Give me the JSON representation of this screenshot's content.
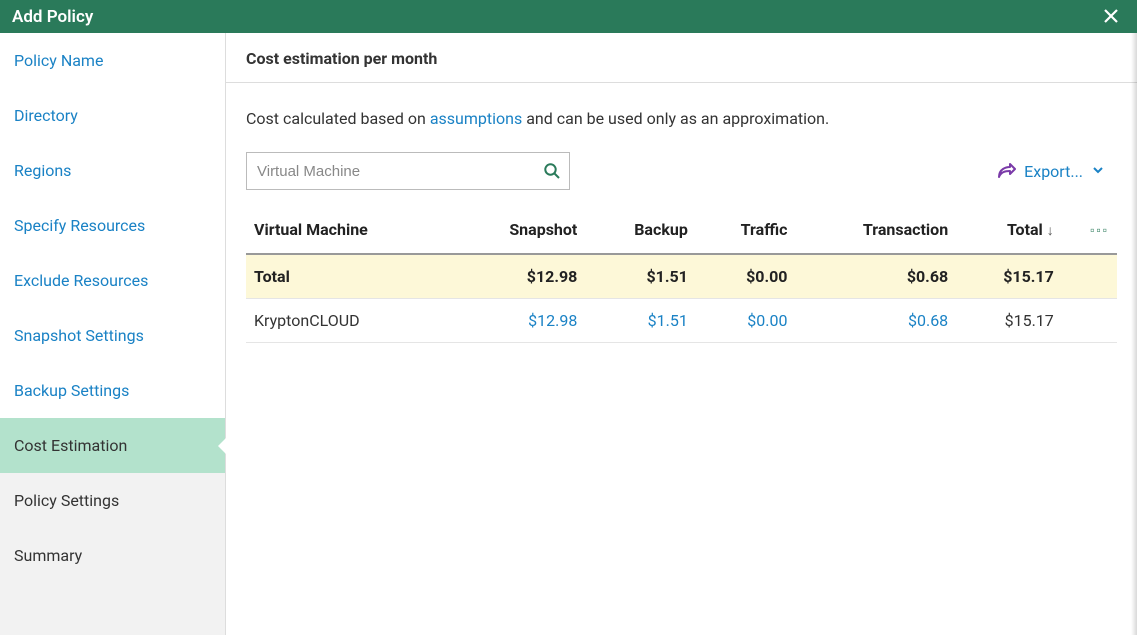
{
  "header": {
    "title": "Add Policy"
  },
  "sidebar": {
    "items": [
      {
        "label": "Policy Name"
      },
      {
        "label": "Directory"
      },
      {
        "label": "Regions"
      },
      {
        "label": "Specify Resources"
      },
      {
        "label": "Exclude Resources"
      },
      {
        "label": "Snapshot Settings"
      },
      {
        "label": "Backup Settings"
      },
      {
        "label": "Cost Estimation"
      },
      {
        "label": "Policy Settings"
      },
      {
        "label": "Summary"
      }
    ],
    "active_index": 7
  },
  "main": {
    "title": "Cost estimation per month",
    "desc_pre": "Cost calculated based on ",
    "desc_link": "assumptions",
    "desc_post": " and can be used only as an approximation.",
    "search_placeholder": "Virtual Machine",
    "export_label": "Export...",
    "columns": {
      "c0": "Virtual Machine",
      "c1": "Snapshot",
      "c2": "Backup",
      "c3": "Traffic",
      "c4": "Transaction",
      "c5": "Total"
    },
    "total_row": {
      "label": "Total",
      "snapshot": "$12.98",
      "backup": "$1.51",
      "traffic": "$0.00",
      "transaction": "$0.68",
      "total": "$15.17"
    },
    "rows": [
      {
        "name": "KryptonCLOUD",
        "snapshot": "$12.98",
        "backup": "$1.51",
        "traffic": "$0.00",
        "transaction": "$0.68",
        "total": "$15.17"
      }
    ]
  }
}
